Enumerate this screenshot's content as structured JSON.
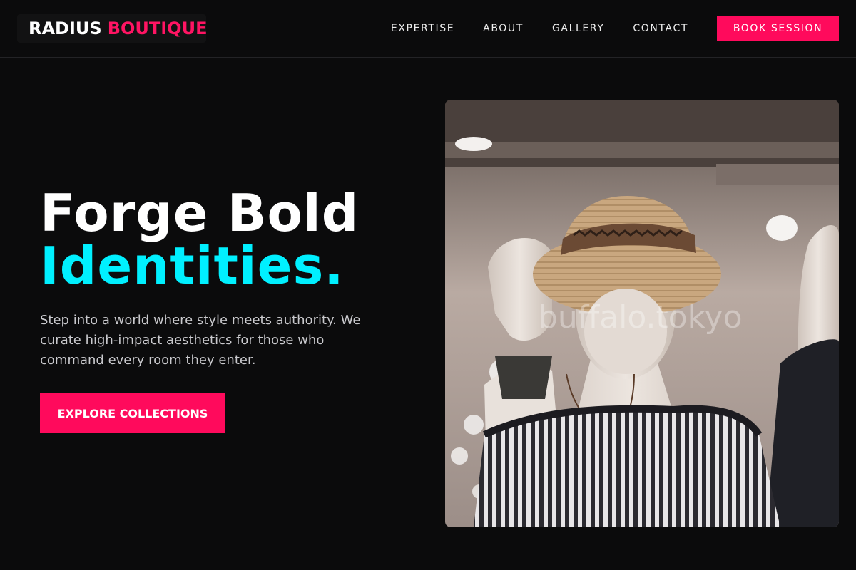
{
  "brand": {
    "part1": "RADIUS",
    "part2": "BOUTIQUE"
  },
  "nav": {
    "links": [
      "EXPERTISE",
      "ABOUT",
      "GALLERY",
      "CONTACT"
    ],
    "cta": "BOOK SESSION"
  },
  "hero": {
    "headline_line1": "Forge Bold",
    "headline_line2": "Identities.",
    "subtext": "Step into a world where style meets authority. We curate high-impact aesthetics for those who command every room they enter.",
    "cta": "EXPLORE COLLECTIONS",
    "image_watermark": "buffalo.tokyo"
  },
  "colors": {
    "background": "#0b0b0c",
    "accent_pink": "#ff0a5c",
    "accent_cyan": "#00f0ff"
  }
}
